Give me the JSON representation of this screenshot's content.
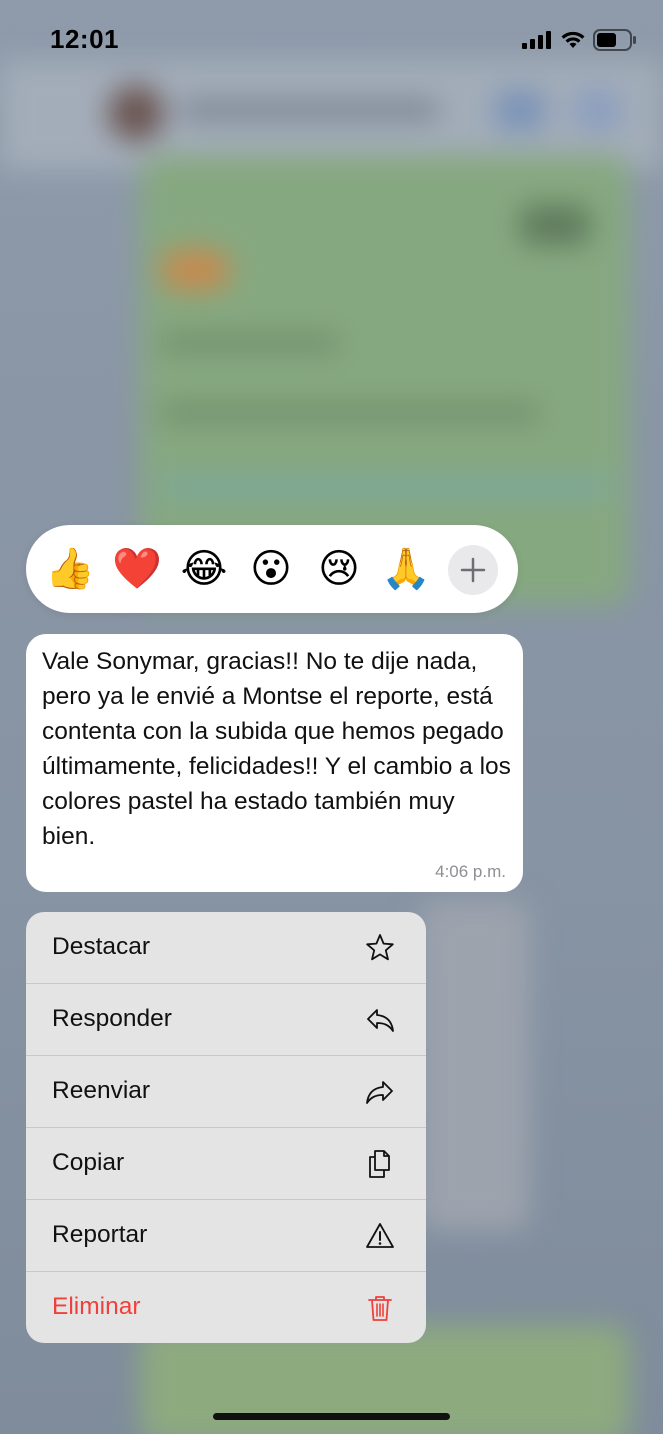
{
  "status_bar": {
    "time": "12:01"
  },
  "reactions": [
    {
      "emoji": "👍",
      "icon": "thumbs-up"
    },
    {
      "emoji": "❤️",
      "icon": "red-heart"
    },
    {
      "emoji": "😂",
      "icon": "face-with-tears-of-joy"
    },
    {
      "emoji": "😮",
      "icon": "face-with-open-mouth"
    },
    {
      "emoji": "😢",
      "icon": "crying-face"
    },
    {
      "emoji": "🙏",
      "icon": "folded-hands"
    }
  ],
  "reaction_add_icon": "plus-icon",
  "message": {
    "text": "Vale Sonymar, gracias!! No te dije nada, pero ya le envié a Montse el reporte, está contenta con la subida que hemos pegado últimamente, felicidades!! Y el cambio a los colores pastel ha estado también muy bien.",
    "time": "4:06 p.m."
  },
  "menu": {
    "items": [
      {
        "label": "Destacar",
        "icon": "star-icon"
      },
      {
        "label": "Responder",
        "icon": "reply-icon"
      },
      {
        "label": "Reenviar",
        "icon": "forward-icon"
      },
      {
        "label": "Copiar",
        "icon": "copy-icon"
      },
      {
        "label": "Reportar",
        "icon": "warning-icon"
      },
      {
        "label": "Eliminar",
        "icon": "trash-icon"
      }
    ]
  },
  "colors": {
    "danger": "#f0403a",
    "menu_bg": "#e4e4e5",
    "bubble_bg": "#ffffff"
  }
}
